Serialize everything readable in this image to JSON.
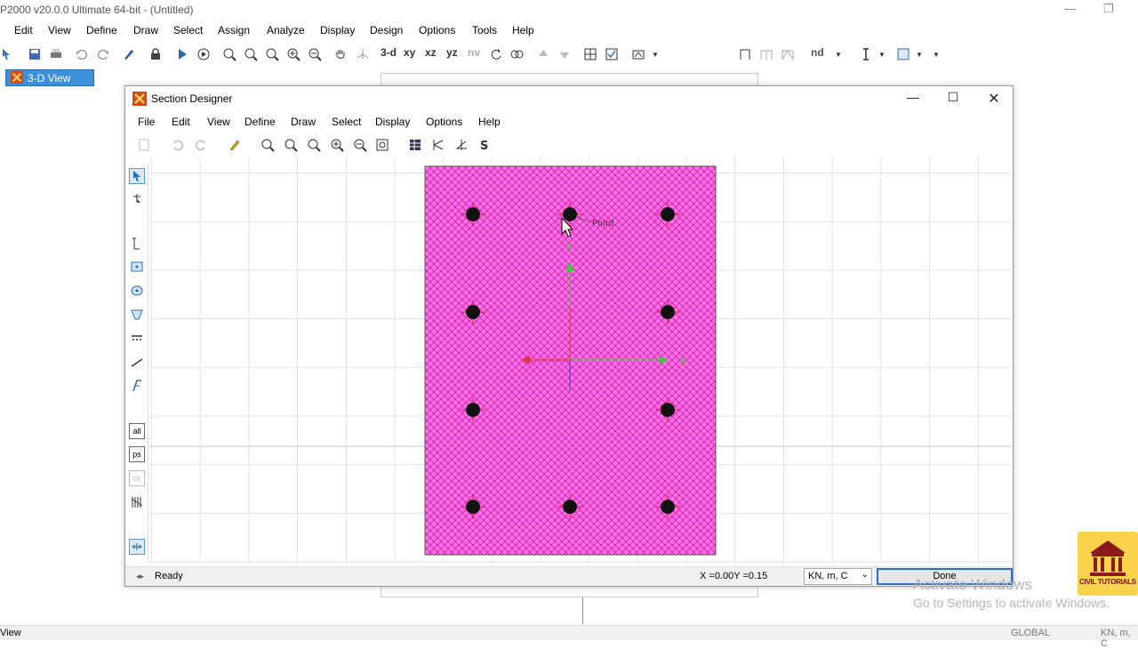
{
  "app": {
    "title": "P2000 v20.0.0 Ultimate 64-bit - (Untitled)",
    "menu": [
      "Edit",
      "View",
      "Define",
      "Draw",
      "Select",
      "Assign",
      "Analyze",
      "Display",
      "Design",
      "Options",
      "Tools",
      "Help"
    ],
    "toolbar_text": {
      "t3d": "3-d",
      "txy": "xy",
      "txz": "xz",
      "tyz": "yz",
      "tnv": "nv",
      "tnd": "nd"
    },
    "tab_label": "3-D View",
    "status_left": "View",
    "status_global": "GLOBAL",
    "status_units": "KN, m, C"
  },
  "section_designer": {
    "title": "Section Designer",
    "menu": [
      "File",
      "Edit",
      "View",
      "Define",
      "Draw",
      "Select",
      "Display",
      "Options",
      "Help"
    ],
    "tooltip": "Point",
    "axis_labels": {
      "x": "X",
      "y": "Y"
    },
    "status_text": "Ready",
    "coordinates": "X =0.00Y =0.15",
    "units_value": "KN, m, C",
    "done_label": "Done",
    "left_tools_text": {
      "all": "all",
      "ps": "ps",
      "clr": "clr"
    }
  },
  "watermark": {
    "line1": "Activate Windows",
    "line2": "Go to Settings to activate Windows."
  },
  "logo": {
    "caption": "CIVIL TUTORIALS"
  },
  "colors": {
    "section_fill": "#ff6fe6",
    "section_hatch": "#d10f9e",
    "rebar": "#111111",
    "accent": "#2f6fd0",
    "axis_x": "#44c244",
    "axis_y": "#44c244"
  }
}
